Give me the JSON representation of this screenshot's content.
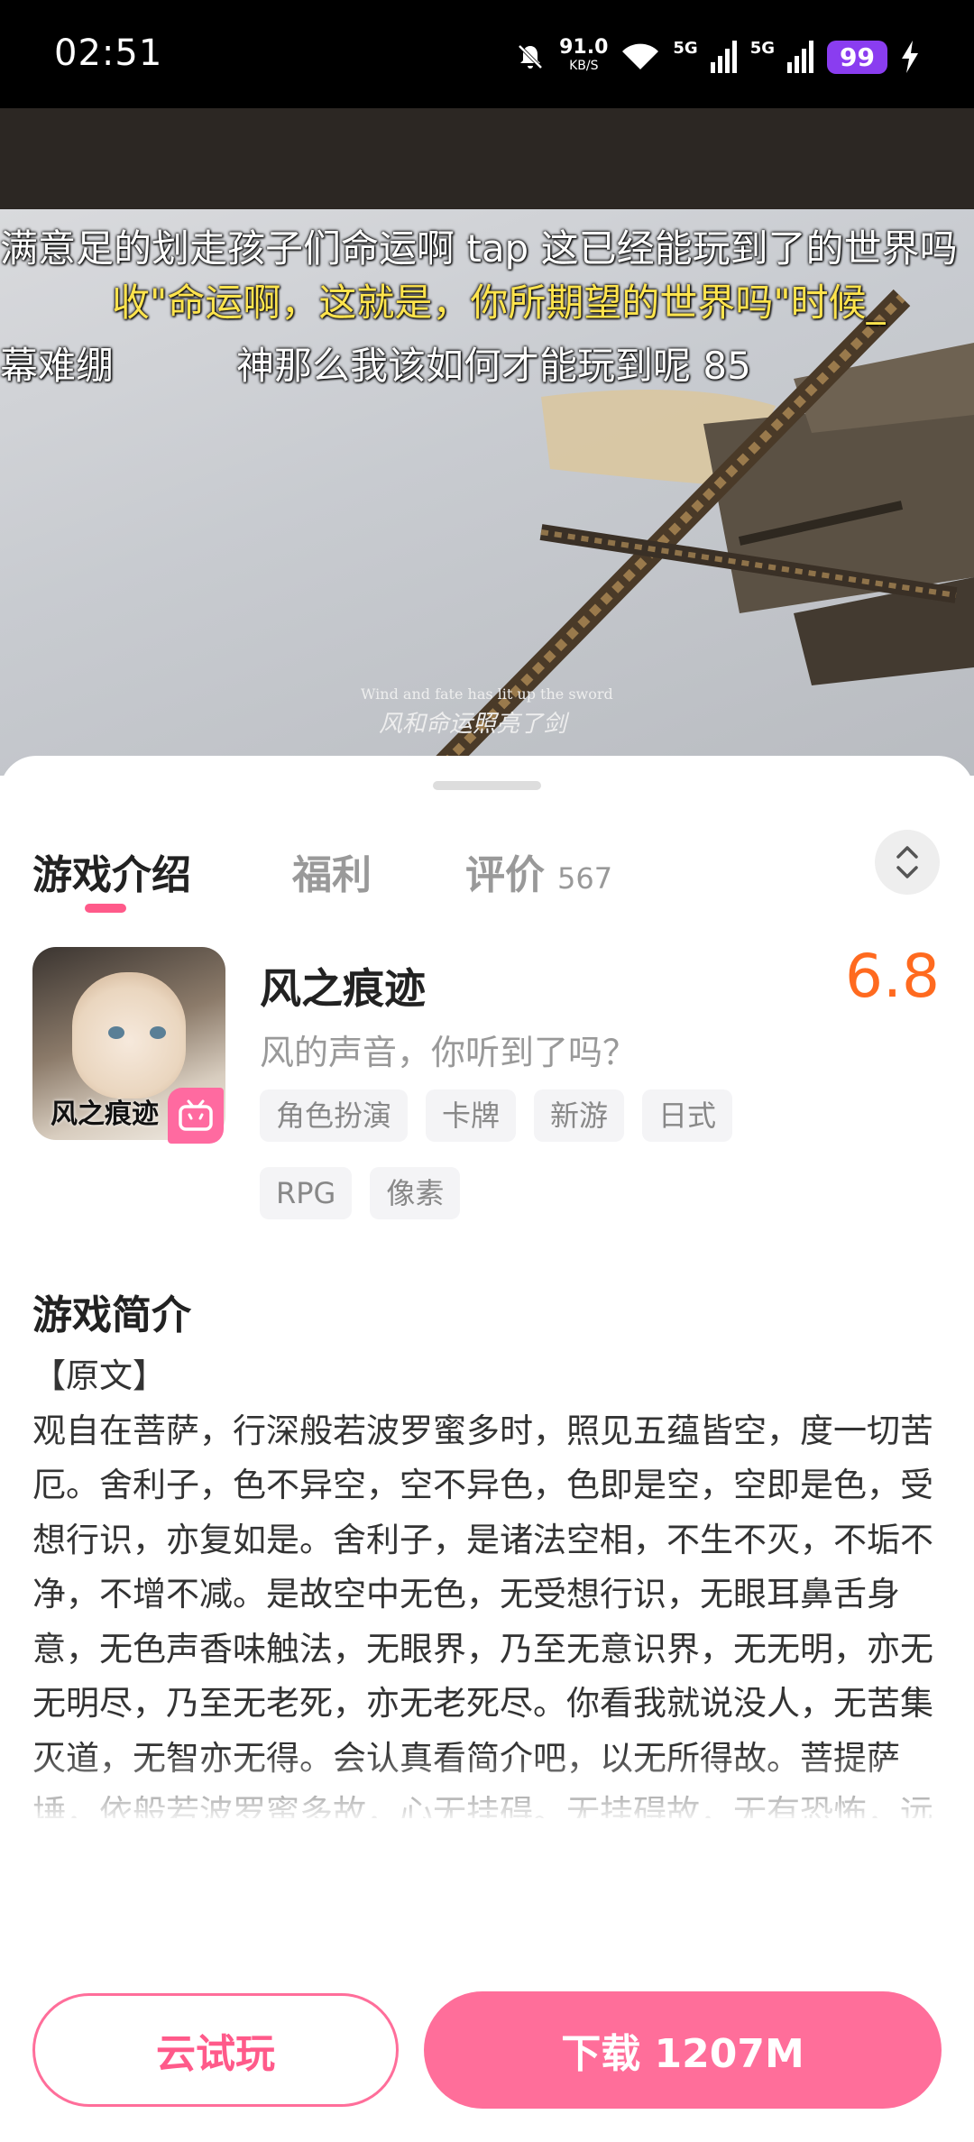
{
  "status_bar": {
    "time": "02:51",
    "net_speed": "91.0",
    "net_unit": "KB/S",
    "signal_1": "5G",
    "signal_2": "5G",
    "battery": "99",
    "icons": [
      "mute-icon",
      "wifi-icon",
      "signal-icon",
      "signal-icon",
      "charging-icon"
    ]
  },
  "video": {
    "danmaku": [
      "满意足的划走孩子们命运啊 tap 这已经能玩到了的世界吗",
      "收\"命运啊，这就是，你所期望的世界吗\"时候_",
      "幕难绷",
      "神那么我该如何才能玩到呢   85"
    ],
    "subtitle_en": "Wind and fate has lit up the sword",
    "subtitle_cn": "风和命运照亮了剑"
  },
  "tabs": [
    {
      "label": "游戏介绍",
      "active": true
    },
    {
      "label": "福利",
      "active": false
    },
    {
      "label": "评价",
      "count": "567",
      "active": false
    }
  ],
  "game": {
    "name": "风之痕迹",
    "slogan": "风的声音，你听到了吗？",
    "score": "6.8",
    "icon_text": "风之痕迹",
    "tags": [
      "角色扮演",
      "卡牌",
      "新游",
      "日式",
      "RPG",
      "像素"
    ]
  },
  "intro": {
    "title": "游戏简介",
    "heading": "【原文】",
    "body": "观自在菩萨，行深般若波罗蜜多时，照见五蕴皆空，度一切苦厄。舍利子，色不异空，空不异色，色即是空，空即是色，受想行识，亦复如是。舍利子，是诸法空相，不生不灭，不垢不净，不增不减。是故空中无色，无受想行识，无眼耳鼻舌身意，无色声香味触法，无眼界，乃至无意识界，无无明，亦无无明尽，乃至无老死，亦无老死尽。你看我就说没人，无苦集灭道，无智亦无得。会认真看简介吧，以无所得故。菩提萨埵，依般若波罗蜜多故，心无挂碍。无挂碍故，无有恐怖，远离颠倒梦想，究竟涅盘。三世诸佛，依般若波罗蜜多"
  },
  "actions": {
    "cloud_play": "云试玩",
    "download": "下载 1207M"
  },
  "colors": {
    "accent": "#ff6e9a",
    "score": "#ff6a1f",
    "battery": "#8a3df0"
  }
}
